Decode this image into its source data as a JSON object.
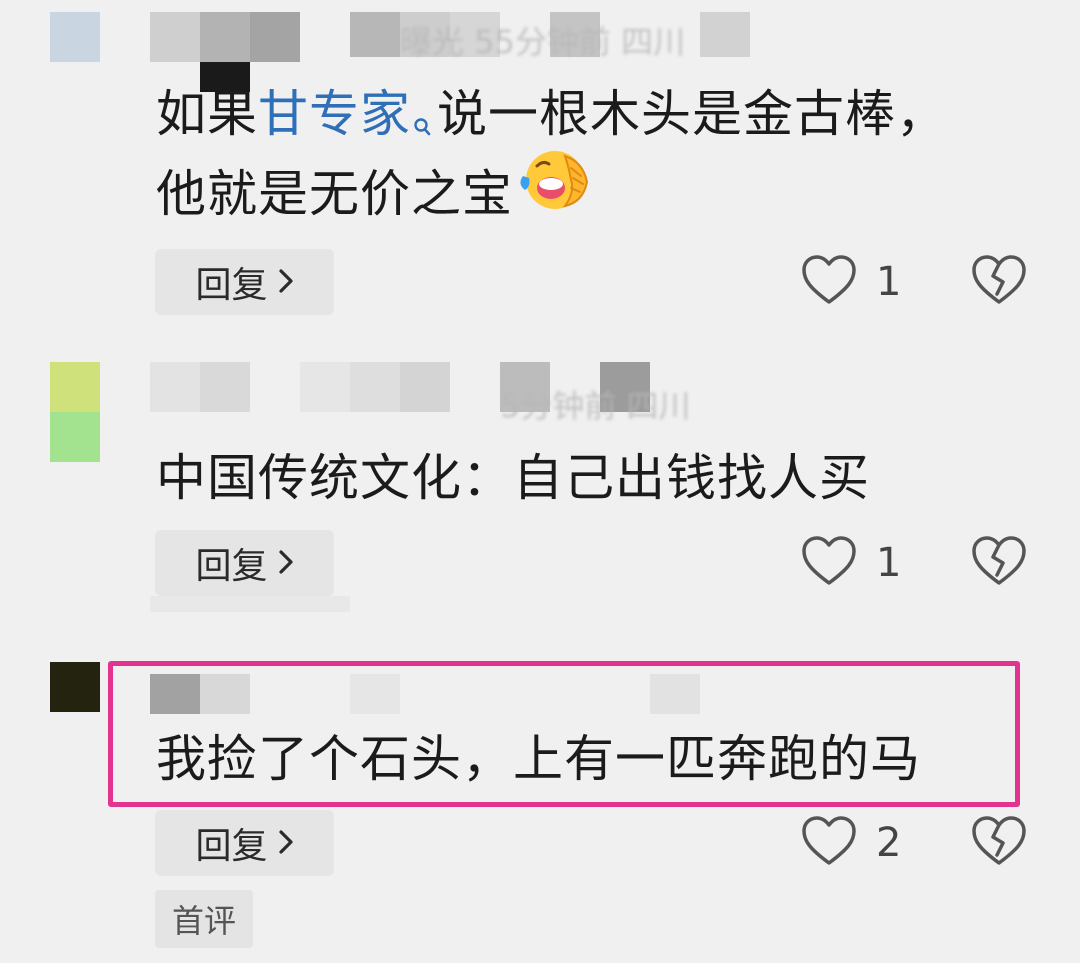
{
  "colors": {
    "background": "#f0f0f0",
    "mention": "#2e6fb8",
    "highlight": "#e2338f",
    "reply_button_bg": "#e5e5e5"
  },
  "comments": [
    {
      "meta_blurred": "曝光 55分钟前 四川",
      "text_before": "如果",
      "mention": "甘专家",
      "mention_icon": "search-icon",
      "text_after": "说一根木头是金古棒，",
      "text_line2": "他就是无价之宝",
      "emoji": "laughing-crying-emoji",
      "reply_label": "回复",
      "like_count": "1"
    },
    {
      "meta_blurred": "5分钟前 四川",
      "text": "中国传统文化：自己出钱找人买",
      "reply_label": "回复",
      "like_count": "1"
    },
    {
      "text": "我捡了个石头，上有一匹奔跑的马",
      "reply_label": "回复",
      "like_count": "2",
      "tag": "首评"
    }
  ]
}
